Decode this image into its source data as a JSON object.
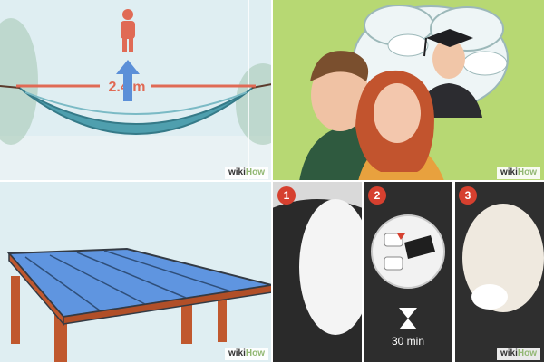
{
  "panels": [
    {
      "measurement": "2.4 m",
      "watermark": {
        "wiki": "wiki",
        "how": "How"
      }
    },
    {
      "watermark": {
        "wiki": "wiki",
        "how": "How"
      }
    },
    {
      "watermark": {
        "wiki": "wiki",
        "how": "How"
      }
    },
    {
      "steps": [
        "1",
        "2",
        "3"
      ],
      "timer_label": "30 min",
      "watermark": {
        "wiki": "wiki",
        "how": "How"
      }
    }
  ]
}
